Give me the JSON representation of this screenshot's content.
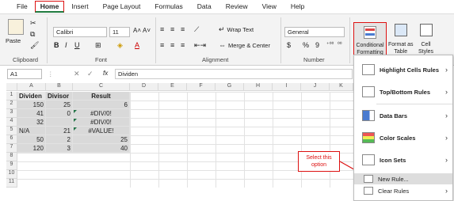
{
  "tabs": [
    "File",
    "Home",
    "Insert",
    "Page Layout",
    "Formulas",
    "Data",
    "Review",
    "View",
    "Help"
  ],
  "active_tab": "Home",
  "ribbon": {
    "clipboard": {
      "paste": "Paste",
      "label": "Clipboard"
    },
    "font": {
      "name": "Calibri",
      "size": "11",
      "label": "Font"
    },
    "alignment": {
      "wrap_text": "Wrap Text",
      "merge_center": "Merge & Center",
      "label": "Alignment"
    },
    "number": {
      "format": "General",
      "currency": "$",
      "percent": "%",
      "comma": "9",
      "label": "Number"
    },
    "styles": {
      "cf_line1": "Conditional",
      "cf_line2": "Formatting",
      "fat_line1": "Format as",
      "fat_line2": "Table",
      "cs_line1": "Cell",
      "cs_line2": "Styles"
    }
  },
  "formula_bar": {
    "name_box": "A1",
    "fx": "fx",
    "content": "Dividen"
  },
  "columns": [
    "A",
    "B",
    "C",
    "D",
    "E",
    "F",
    "G",
    "H",
    "I",
    "J",
    "K"
  ],
  "rows": [
    "1",
    "2",
    "3",
    "4",
    "5",
    "6",
    "7",
    "8",
    "9",
    "10",
    "11"
  ],
  "cells": {
    "a1": "Dividen",
    "b1": "Divisor",
    "c1": "Result",
    "a2": "150",
    "b2": "25",
    "c2": "6",
    "a3": "41",
    "b3": "0",
    "c3": "#DIV/0!",
    "a4": "32",
    "b4": "",
    "c4": "#DIV/0!",
    "a5": "N/A",
    "b5": "21",
    "c5": "#VALUE!",
    "a6": "50",
    "b6": "2",
    "c6": "25",
    "a7": "120",
    "b7": "3",
    "c7": "40"
  },
  "menu": {
    "highlight": "Highlight Cells Rules",
    "topbottom": "Top/Bottom Rules",
    "databars": "Data Bars",
    "colorscales": "Color Scales",
    "iconsets": "Icon Sets",
    "newrule": "New Rule...",
    "clearrules": "Clear Rules"
  },
  "callout": {
    "line1": "Select this",
    "line2": "option"
  },
  "colors": {
    "accent": "#217346",
    "highlight_red": "#dd1111"
  }
}
